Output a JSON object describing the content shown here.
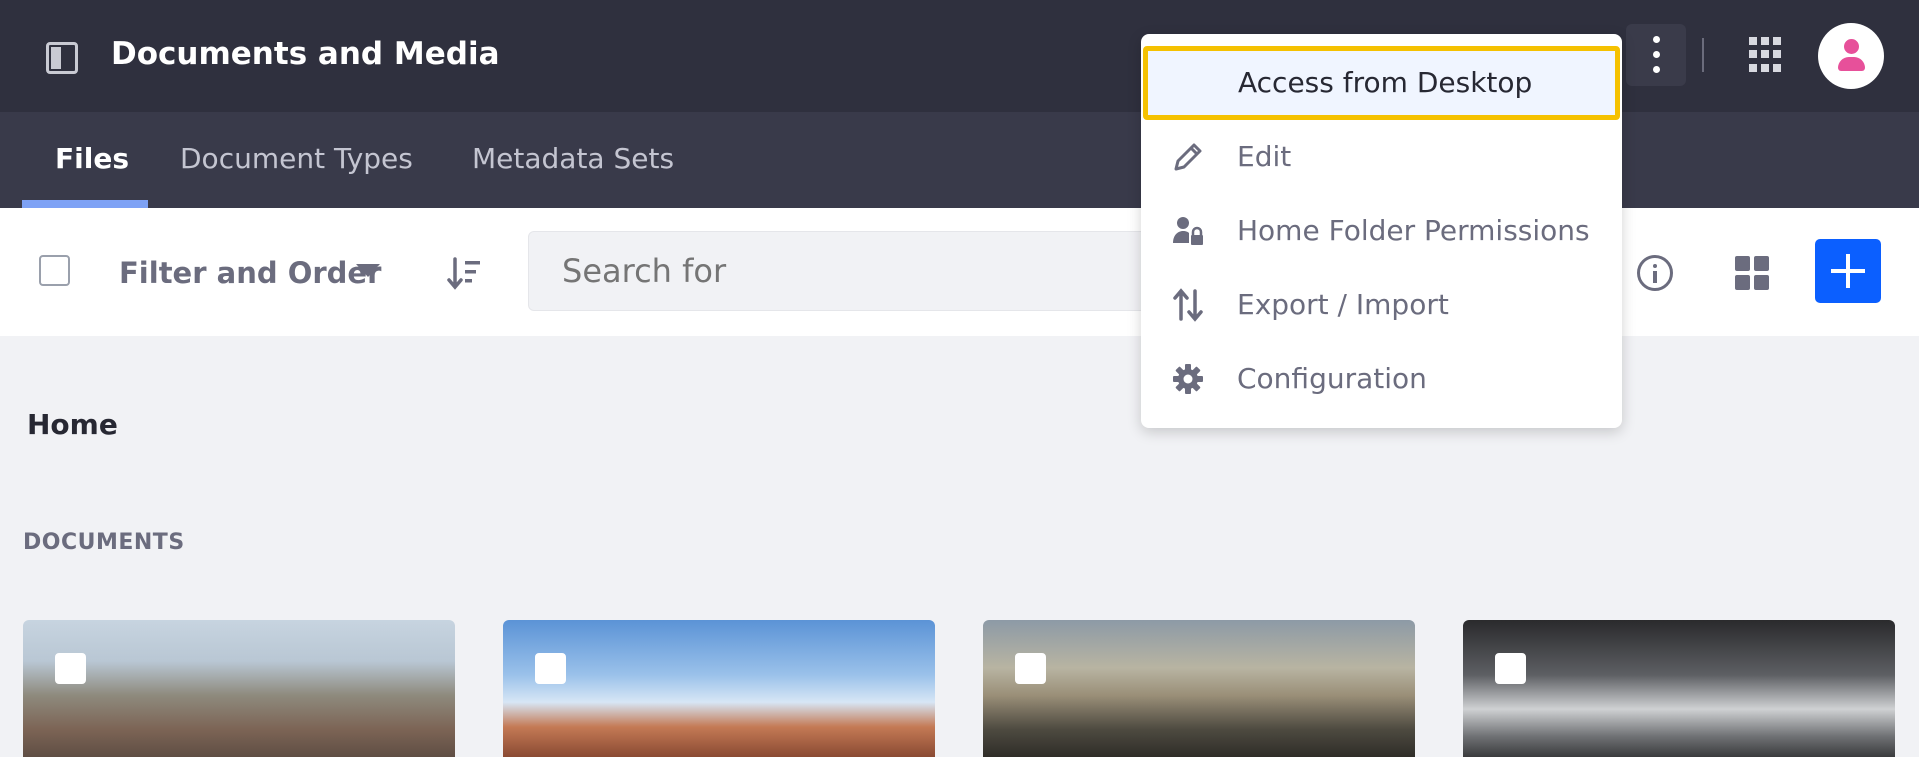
{
  "header": {
    "title": "Documents and Media"
  },
  "tabs": [
    {
      "label": "Files",
      "active": true
    },
    {
      "label": "Document Types",
      "active": false
    },
    {
      "label": "Metadata Sets",
      "active": false
    }
  ],
  "toolbar": {
    "filter_label": "Filter and Order",
    "search_placeholder": "Search for"
  },
  "breadcrumb": "Home",
  "section": "DOCUMENTS",
  "menu": {
    "items": [
      {
        "label": "Access from Desktop",
        "icon": "none",
        "highlighted": true
      },
      {
        "label": "Edit",
        "icon": "pencil-icon"
      },
      {
        "label": "Home Folder Permissions",
        "icon": "user-lock-icon"
      },
      {
        "label": "Export / Import",
        "icon": "import-export-icon"
      },
      {
        "label": "Configuration",
        "icon": "gear-icon"
      }
    ]
  },
  "colors": {
    "topbar": "#2f303e",
    "tabbar": "#393a4a",
    "accent": "#0b5fff",
    "highlight_border": "#f5c100",
    "avatar": "#e7509a"
  }
}
